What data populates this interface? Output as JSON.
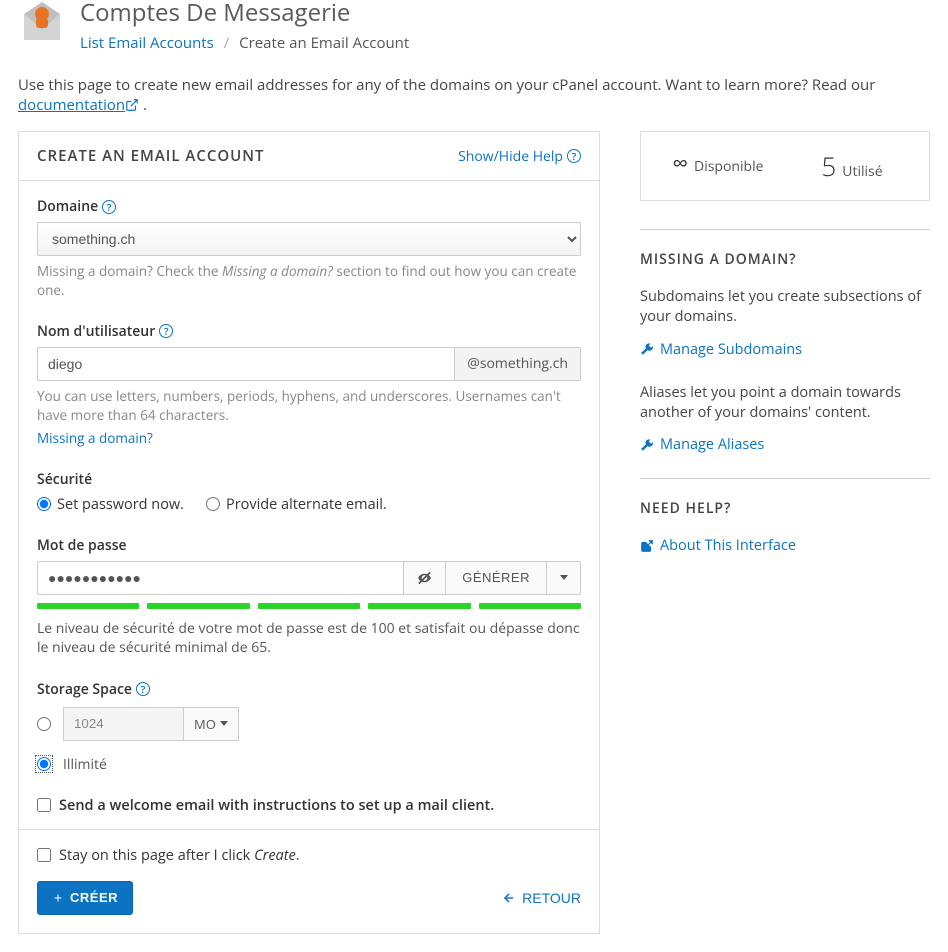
{
  "header": {
    "title": "Comptes De Messagerie",
    "breadcrumb_link": "List Email Accounts",
    "breadcrumb_current": "Create an Email Account"
  },
  "intro": {
    "text_a": "Use this page to create new email addresses for any of the domains on your cPanel account. Want to learn more? Read our ",
    "doc_link": "documentation",
    "text_b": " ."
  },
  "panel": {
    "title": "CREATE AN EMAIL ACCOUNT",
    "toggle_help": "Show/Hide Help",
    "domain": {
      "label": "Domaine",
      "value": "something.ch",
      "help_a": "Missing a domain? Check the ",
      "help_em": "Missing a domain?",
      "help_b": " section to find out how you can create one."
    },
    "username": {
      "label": "Nom d'utilisateur",
      "value": "diego",
      "addon": "@something.ch",
      "help": "You can use letters, numbers, periods, hyphens, and underscores. Usernames can't have more than 64 characters.",
      "missing_link": "Missing a domain?"
    },
    "security": {
      "label": "Sécurité",
      "opt_now": "Set password now.",
      "opt_alt": "Provide alternate email."
    },
    "password": {
      "label": "Mot de passe",
      "value": "●●●●●●●●●●●",
      "gen": "GÉNÉRER",
      "strength_text": "Le niveau de sécurité de votre mot de passe est de 100 et satisfait ou dépasse donc le niveau de sécurité minimal de 65."
    },
    "storage": {
      "label": "Storage Space",
      "value": "1024",
      "unit": "MO",
      "unlimited": "Illimité"
    },
    "welcome_chk": "Send a welcome email with instructions to set up a mail client.",
    "stay_chk_a": "Stay on this page after I click ",
    "stay_chk_em": "Create",
    "stay_chk_b": ".",
    "create_btn": "CRÉER",
    "back_btn": "RETOUR"
  },
  "side": {
    "stats": {
      "available_lbl": "Disponible",
      "used_num": "5",
      "used_lbl": "Utilisé"
    },
    "missing": {
      "title": "MISSING A DOMAIN?",
      "sub_text": "Subdomains let you create subsections of your domains.",
      "sub_link": "Manage Subdomains",
      "alias_text": "Aliases let you point a domain towards another of your domains' content.",
      "alias_link": "Manage Aliases"
    },
    "help": {
      "title": "NEED HELP?",
      "about_link": "About This Interface"
    }
  }
}
